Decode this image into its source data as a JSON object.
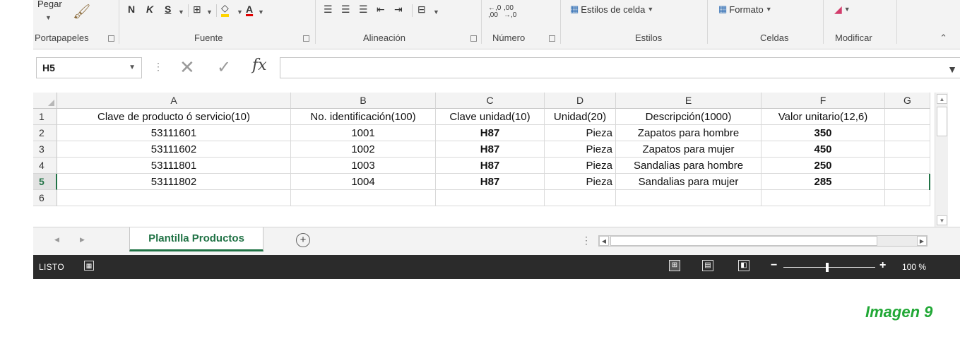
{
  "ribbon": {
    "clipboard": {
      "paste_label": "Pegar",
      "group_label": "Portapapeles"
    },
    "font": {
      "bold": "N",
      "italic": "K",
      "underline": "S",
      "group_label": "Fuente",
      "fill_color": "#ffd400",
      "font_color": "#e00000"
    },
    "alignment": {
      "group_label": "Alineación"
    },
    "number": {
      "increase_decimals": "←,0 ,00",
      "decrease_decimals": ",00 →,0",
      "group_label": "Número"
    },
    "styles": {
      "cell_styles_label": "Estilos de celda",
      "group_label": "Estilos"
    },
    "cells": {
      "format_label": "Formato",
      "group_label": "Celdas"
    },
    "edit": {
      "group_label": "Modificar"
    }
  },
  "formula_bar": {
    "name_box": "H5",
    "fx": "fx",
    "value": ""
  },
  "columns": [
    "A",
    "B",
    "C",
    "D",
    "E",
    "F",
    "G"
  ],
  "rows": [
    {
      "num": "1",
      "cells": [
        "Clave de producto ó servicio(10)",
        "No. identificación(100)",
        "Clave unidad(10)",
        "Unidad(20)",
        "Descripción(1000)",
        "Valor unitario(12,6)",
        ""
      ]
    },
    {
      "num": "2",
      "cells": [
        "53111601",
        "1001",
        "H87",
        "Pieza",
        "Zapatos para hombre",
        "350",
        ""
      ]
    },
    {
      "num": "3",
      "cells": [
        "53111602",
        "1002",
        "H87",
        "Pieza",
        "Zapatos para mujer",
        "450",
        ""
      ]
    },
    {
      "num": "4",
      "cells": [
        "53111801",
        "1003",
        "H87",
        "Pieza",
        "Sandalias para hombre",
        "250",
        ""
      ]
    },
    {
      "num": "5",
      "cells": [
        "53111802",
        "1004",
        "H87",
        "Pieza",
        "Sandalias para mujer",
        "285",
        ""
      ]
    },
    {
      "num": "6",
      "cells": [
        "",
        "",
        "",
        "",
        "",
        "",
        ""
      ]
    }
  ],
  "sheet_tabs": {
    "active": "Plantilla Productos",
    "add_label": "+"
  },
  "status_bar": {
    "mode": "LISTO",
    "zoom": "100 %"
  },
  "caption": "Imagen 9"
}
